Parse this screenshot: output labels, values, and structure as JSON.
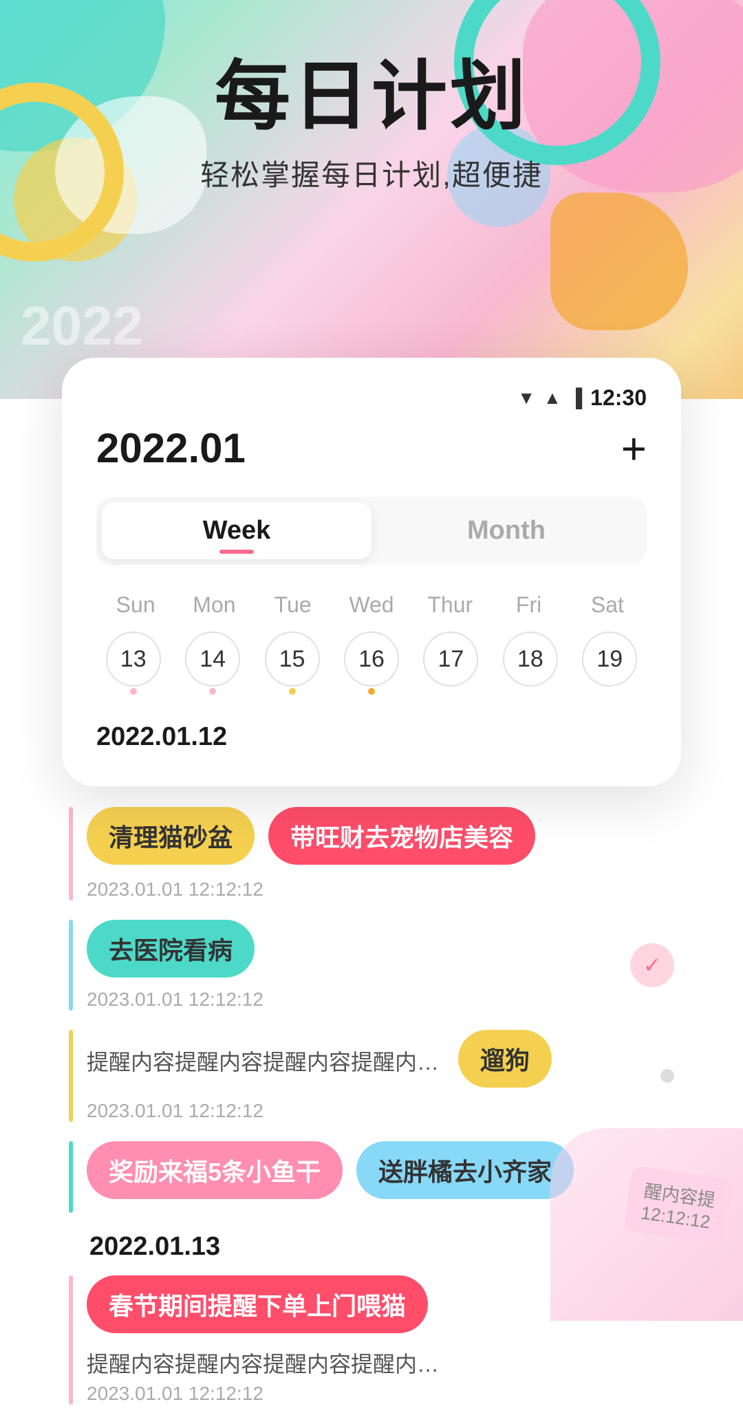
{
  "app": {
    "title": "每日计划",
    "subtitle": "轻松掌握每日计划,超便捷",
    "year_label": "2022"
  },
  "status_bar": {
    "wifi": "▼",
    "signal": "▲",
    "battery": "🔋",
    "time": "12:30"
  },
  "calendar": {
    "current_date": "2022.01",
    "add_button": "+",
    "tabs": [
      {
        "id": "week",
        "label": "Week",
        "active": true
      },
      {
        "id": "month",
        "label": "Month",
        "active": false
      }
    ],
    "week_days": [
      "Sun",
      "Mon",
      "Tue",
      "Wed",
      "Thur",
      "Fri",
      "Sat"
    ],
    "dates": [
      {
        "num": "13",
        "dot": "pink"
      },
      {
        "num": "14",
        "dot": "pink"
      },
      {
        "num": "15",
        "dot": "yellow"
      },
      {
        "num": "16",
        "dot": "orange"
      },
      {
        "num": "17",
        "dot": "none"
      },
      {
        "num": "18",
        "dot": "none"
      },
      {
        "num": "19",
        "dot": "none"
      }
    ],
    "selected_date": "2022.01.12"
  },
  "tasks": {
    "section1_date": "2022.01.12",
    "items": [
      {
        "id": 1,
        "tag_text": "清理猫砂盆",
        "tag_color": "yellow",
        "extra_tag_text": "带旺财去宠物店美容",
        "extra_tag_color": "red",
        "meta": "2023.01.01  12:12:12",
        "line_color": "pink",
        "has_check": false,
        "has_dot": false
      },
      {
        "id": 2,
        "tag_text": "去医院看病",
        "tag_color": "teal",
        "meta": "2023.01.01  12:12:12",
        "line_color": "blue",
        "has_check": true,
        "has_dot": false
      },
      {
        "id": 3,
        "text": "提醒内容提醒内容提醒内容提醒内容提",
        "tag_text": "遛狗",
        "tag_color": "yellow",
        "meta": "2023.01.01  12:12:12",
        "line_color": "yellow",
        "has_check": false,
        "has_dot": true
      },
      {
        "id": 4,
        "tag_text": "奖励来福5条小鱼干",
        "tag_color": "pink",
        "extra_tag_text": "送胖橘去小齐家",
        "extra_tag_color": "light-teal",
        "line_color": "teal",
        "has_check": false,
        "has_dot": false
      }
    ],
    "section2_date": "2022.01.13",
    "items2": [
      {
        "id": 5,
        "tag_text": "春节期间提醒下单上门喂猫",
        "tag_color": "red",
        "text": "提醒内容提醒内容提醒内容提醒内容提醒内容提醒内容提醒",
        "meta": "2023.01.01  12:12:12",
        "line_color": "pink",
        "has_check": false
      }
    ]
  }
}
